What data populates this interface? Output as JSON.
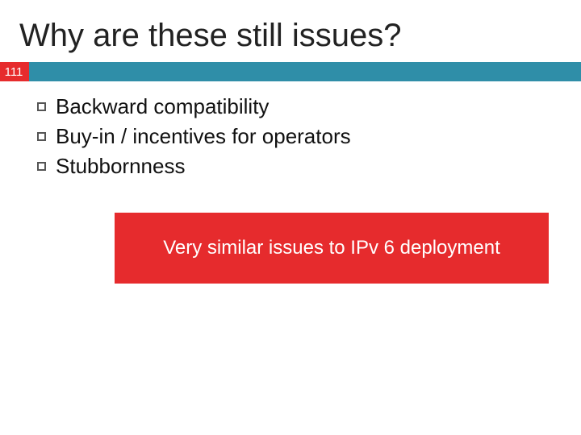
{
  "slide": {
    "title": "Why are these still issues?",
    "number": "111",
    "bullets": [
      "Backward compatibility",
      "Buy-in / incentives for operators",
      "Stubbornness"
    ],
    "callout": "Very similar issues to IPv 6 deployment"
  }
}
